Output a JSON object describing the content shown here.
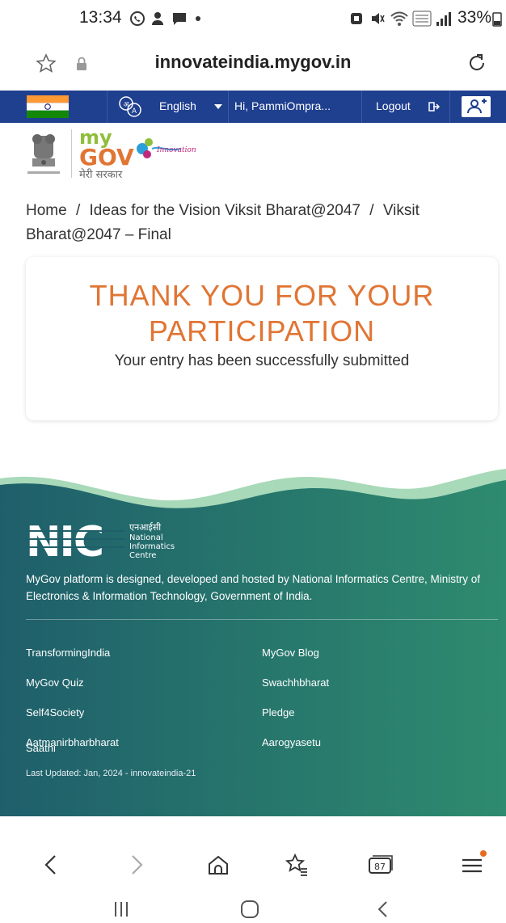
{
  "status_bar": {
    "time": "13:34",
    "battery": "33%"
  },
  "url_bar": {
    "url": "innovateindia.mygov.in"
  },
  "top_nav": {
    "language": "English",
    "greeting": "Hi, PammiOmpra...",
    "logout": "Logout"
  },
  "logo": {
    "mygov_tagline": "मेरी सरकार",
    "innovation_text": "Innovation"
  },
  "breadcrumb": {
    "home": "Home",
    "separator": "/",
    "section": "Ideas for the Vision Viksit Bharat@2047",
    "current": "Viksit Bharat@2047 – Final"
  },
  "thanks": {
    "title_line1": "THANK YOU FOR YOUR",
    "title_line2": "PARTICIPATION",
    "subtitle": "Your entry has been successfully submitted"
  },
  "footer": {
    "nic_hindi": "एनआईसी",
    "nic_name_1": "National",
    "nic_name_2": "Informatics",
    "nic_name_3": "Centre",
    "nic_letters": "NIC",
    "description": "MyGov platform is designed, developed and hosted by National Informatics Centre, Ministry of Electronics & Information Technology, Government of India.",
    "links_left": [
      "TransformingIndia",
      "MyGov Quiz",
      "Self4Society",
      "Aatmanirbharbharat",
      "Saathi"
    ],
    "links_right": [
      "MyGov Blog",
      "Swachhbharat",
      "Pledge",
      "Aarogyasetu"
    ],
    "last_updated": "Last Updated: Jan, 2024 - innovateindia-21",
    "colors": {
      "dark": "#1f5f6b",
      "teal": "#2e8b6e",
      "wave_light": "#a8d9b8"
    }
  },
  "browser_toolbar": {
    "tab_count": "87"
  },
  "colors": {
    "nav_blue": "#1f3f8f",
    "accent_orange": "#e07534"
  }
}
